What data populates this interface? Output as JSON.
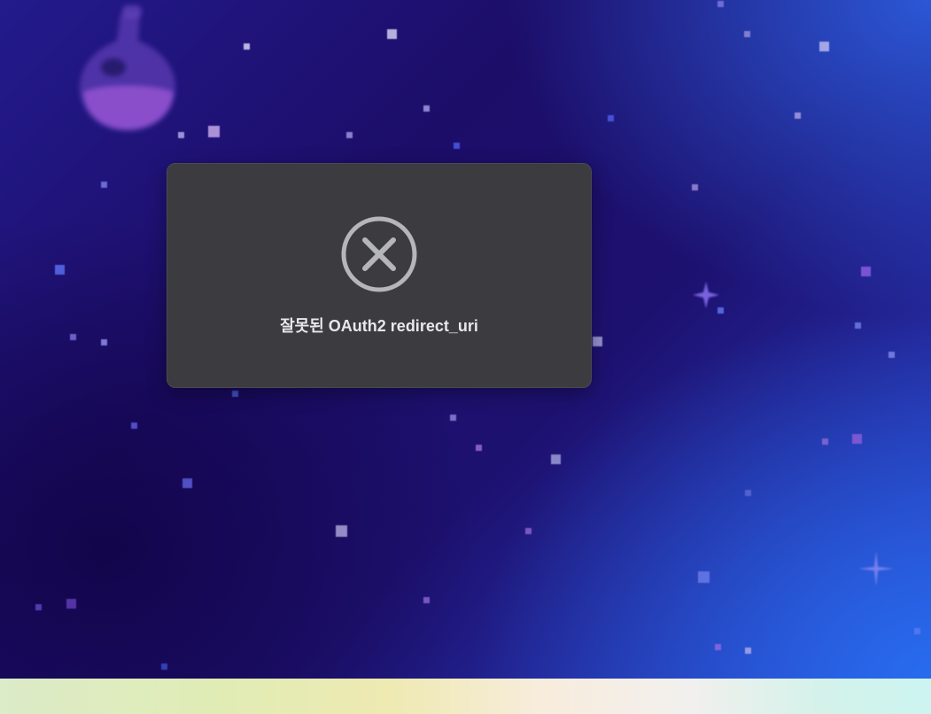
{
  "dialog": {
    "icon": "error-circle-x-icon",
    "message": "잘못된 OAuth2 redirect_uri"
  },
  "background": {
    "decoration_icon": "potion-flask-icon",
    "sparkle_icon": "four-point-sparkle-icon"
  },
  "colors": {
    "dialog_bg": "#3b3b40",
    "icon_color": "#b5b6bc",
    "message_color": "#e8e8ec"
  }
}
